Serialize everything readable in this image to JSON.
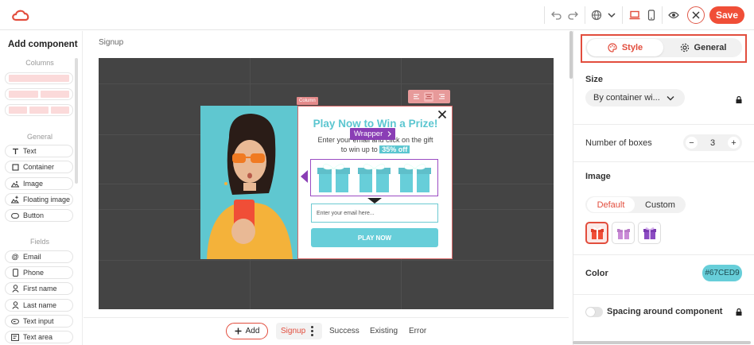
{
  "toolbar": {
    "save_label": "Save"
  },
  "left_panel": {
    "title": "Add component",
    "columns_label": "Columns",
    "general_label": "General",
    "fields_label": "Fields",
    "general_items": [
      {
        "label": "Text",
        "icon": "text-icon"
      },
      {
        "label": "Container",
        "icon": "container-icon"
      },
      {
        "label": "Image",
        "icon": "image-icon"
      },
      {
        "label": "Floating image",
        "icon": "floating-image-icon"
      },
      {
        "label": "Button",
        "icon": "button-icon"
      }
    ],
    "field_items": [
      {
        "label": "Email",
        "icon": "at-icon"
      },
      {
        "label": "Phone",
        "icon": "phone-icon"
      },
      {
        "label": "First name",
        "icon": "user-icon"
      },
      {
        "label": "Last name",
        "icon": "user-icon"
      },
      {
        "label": "Text input",
        "icon": "text-input-icon"
      },
      {
        "label": "Text area",
        "icon": "text-area-icon"
      }
    ]
  },
  "canvas": {
    "breadcrumb": "Signup",
    "column_tag": "Column",
    "wrapper_tag": "Wrapper",
    "popup": {
      "title": "Play Now to Win a Prize!",
      "subtitle_line1": "Enter your email and click on the gift",
      "subtitle_line2": "to win up to",
      "discount": "35% off",
      "email_placeholder": "Enter your email here...",
      "cta": "PLAY NOW"
    }
  },
  "bottom_bar": {
    "add_label": "Add",
    "tabs": [
      "Signup",
      "Success",
      "Existing",
      "Error"
    ]
  },
  "right_panel": {
    "tab_style": "Style",
    "tab_general": "General",
    "size_label": "Size",
    "size_value": "By container wi...",
    "boxes_label": "Number of boxes",
    "boxes_value": "3",
    "image_label": "Image",
    "image_default": "Default",
    "image_custom": "Custom",
    "color_label": "Color",
    "color_value": "#67CED9",
    "spacing_label": "Spacing around component"
  },
  "colors": {
    "accent": "#e24d3d",
    "brand_teal": "#67ced9",
    "wrapper_purple": "#8a3eb5"
  }
}
